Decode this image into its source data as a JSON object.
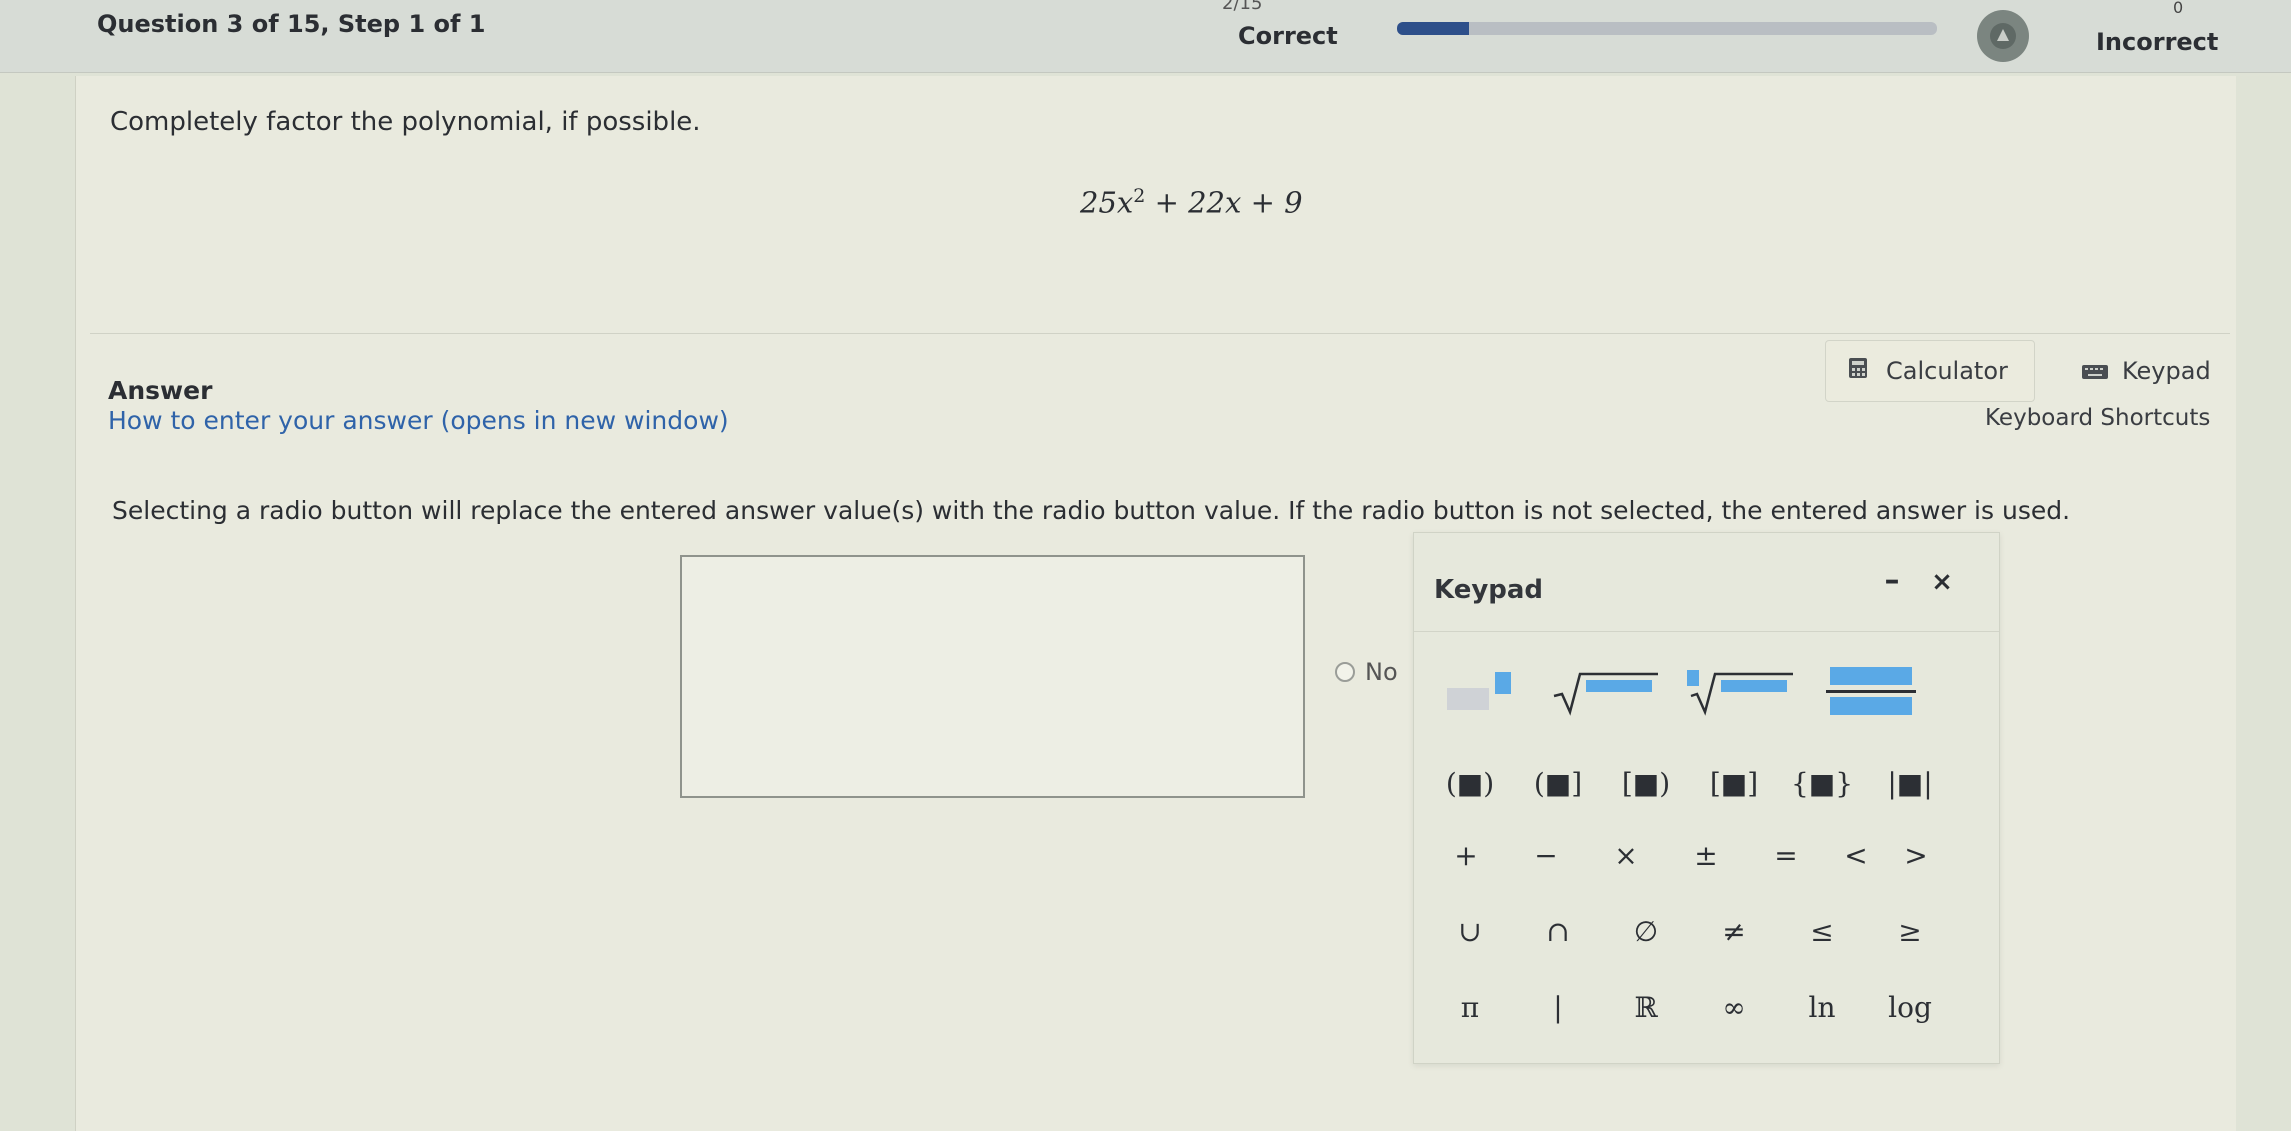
{
  "header": {
    "question_label": "Question 3 of 15,  Step 1 of 1",
    "progress_count": "2/15",
    "progress_fraction": 0.133,
    "correct_label": "Correct",
    "incorrect_count": "0",
    "incorrect_label": "Incorrect"
  },
  "question": {
    "prompt": "Completely factor the polynomial, if possible.",
    "expression": {
      "coef1": "25x",
      "exp": "2",
      "rest": " + 22x + 9"
    }
  },
  "answer": {
    "label": "Answer",
    "howto_link": "How to enter your answer (opens in new window)",
    "calculator_label": "Calculator",
    "keypad_label": "Keypad",
    "shortcuts_label": "Keyboard Shortcuts",
    "instruction": "Selecting a radio button will replace the entered answer value(s) with the radio button value. If the radio button is not selected, the entered answer is used.",
    "radio_option": "No"
  },
  "keypad": {
    "title": "Keypad",
    "minimize": "–",
    "close": "×",
    "rows": [
      [
        "(■)",
        "(■]",
        "[■)",
        "[■]",
        "{■}",
        "|■|"
      ],
      [
        "+",
        "−",
        "×",
        "±",
        "=",
        "<",
        ">"
      ],
      [
        "∪",
        "∩",
        "∅",
        "≠",
        "≤",
        "≥"
      ],
      [
        "π",
        "|",
        "ℝ",
        "∞",
        "ln",
        "log"
      ]
    ]
  },
  "colors": {
    "accent": "#1b78bd",
    "progress": "#2d4f8a",
    "link": "#2f63a9"
  },
  "icons": {
    "calculator": "calculator-icon",
    "keypad": "keyboard-icon",
    "badge": "rank-badge-icon"
  }
}
